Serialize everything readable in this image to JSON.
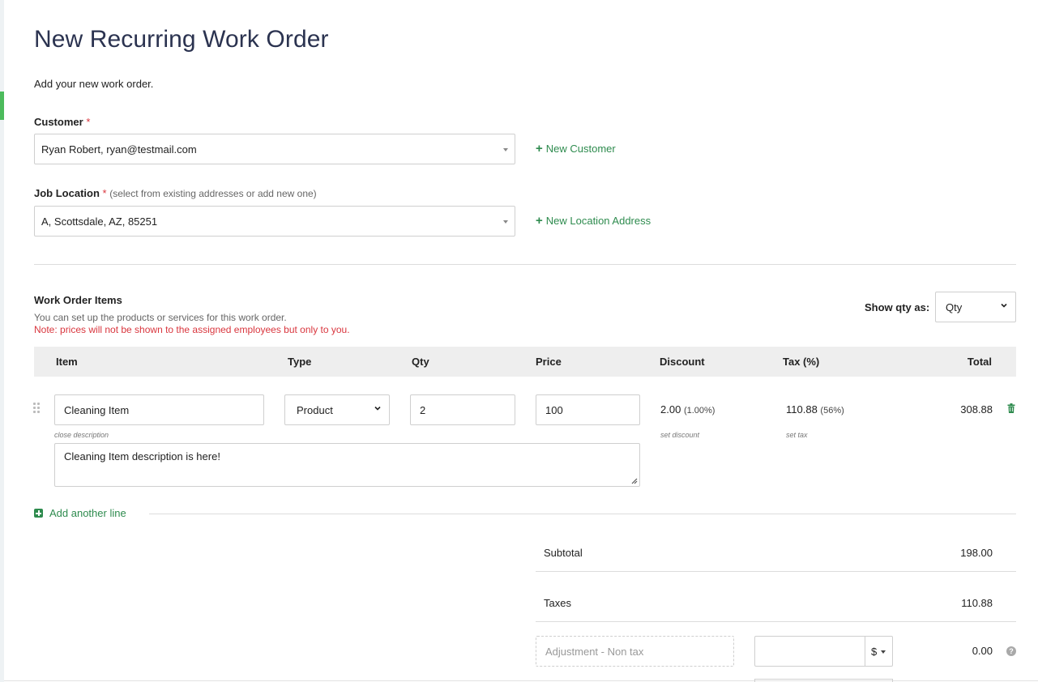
{
  "page": {
    "title": "New Recurring Work Order",
    "intro": "Add your new work order."
  },
  "customer": {
    "label": "Customer",
    "required_mark": "*",
    "value": "Ryan Robert, ryan@testmail.com",
    "new_link": "New Customer"
  },
  "location": {
    "label": "Job Location",
    "required_mark": "*",
    "hint": "(select from existing addresses or add new one)",
    "value": "A, Scottsdale, AZ, 85251",
    "new_link": "New Location Address"
  },
  "items": {
    "title": "Work Order Items",
    "subtitle": "You can set up the products or services for this work order.",
    "note": "Note: prices will not be shown to the assigned employees but only to you.",
    "show_qty_label": "Show qty as:",
    "show_qty_value": "Qty",
    "columns": [
      "Item",
      "Type",
      "Qty",
      "Price",
      "Discount",
      "Tax (%)",
      "Total"
    ],
    "rows": [
      {
        "item": "Cleaning Item",
        "type": "Product",
        "qty": "2",
        "price": "100",
        "discount": "2.00",
        "discount_pct": "(1.00%)",
        "tax": "110.88",
        "tax_pct": "(56%)",
        "total": "308.88",
        "close_description": "close description",
        "set_discount": "set discount",
        "set_tax": "set tax",
        "description": "Cleaning Item description is here!"
      }
    ],
    "add_line": "Add another line"
  },
  "summary": {
    "subtotal_label": "Subtotal",
    "subtotal": "198.00",
    "taxes_label": "Taxes",
    "taxes": "110.88",
    "adjustment_placeholder": "Adjustment - Non tax",
    "adjustment_unit": "$",
    "adjustment_value": "0.00",
    "help": "?"
  },
  "colors": {
    "accent_green": "#2e8b4e",
    "required_red": "#d9363e",
    "title_navy": "#2b3350"
  }
}
